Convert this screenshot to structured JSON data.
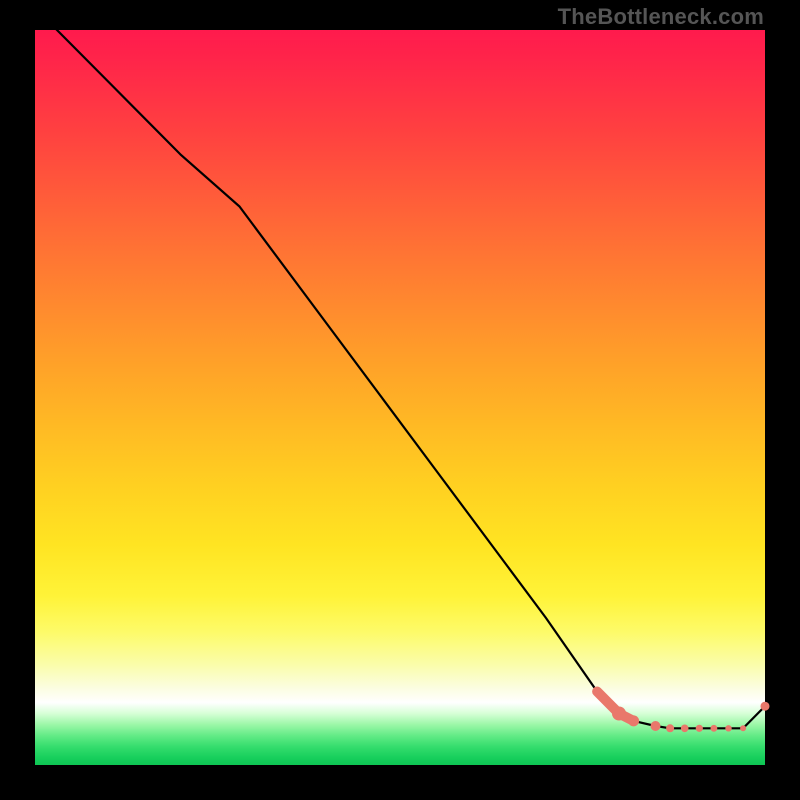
{
  "watermark": "TheBottleneck.com",
  "colors": {
    "line": "#000000",
    "marker_fill": "#e9786b",
    "marker_stroke": "#a24c42",
    "bg_black": "#000000"
  },
  "chart_data": {
    "type": "line",
    "title": "",
    "xlabel": "",
    "ylabel": "",
    "xlim": [
      0,
      100
    ],
    "ylim": [
      0,
      100
    ],
    "grid": false,
    "legend": false,
    "series": [
      {
        "name": "curve",
        "x": [
          0,
          10,
          20,
          28,
          40,
          55,
          70,
          77,
          80,
          82,
          85,
          87,
          89,
          91,
          93,
          95,
          97,
          100
        ],
        "y": [
          103,
          93,
          83,
          76,
          60,
          40,
          20,
          10,
          7,
          6,
          5.3,
          5,
          5,
          5,
          5,
          5,
          5,
          8
        ]
      }
    ],
    "markers": [
      {
        "x": 80,
        "y": 7,
        "r": 7
      },
      {
        "x": 82,
        "y": 6,
        "r": 5.5
      },
      {
        "x": 85,
        "y": 5.3,
        "r": 5
      },
      {
        "x": 87,
        "y": 5,
        "r": 4
      },
      {
        "x": 89,
        "y": 5,
        "r": 3.8
      },
      {
        "x": 91,
        "y": 5,
        "r": 3.6
      },
      {
        "x": 93,
        "y": 5,
        "r": 3.4
      },
      {
        "x": 95,
        "y": 5,
        "r": 3.2
      },
      {
        "x": 97,
        "y": 5,
        "r": 3
      },
      {
        "x": 100,
        "y": 8,
        "r": 4.5
      }
    ],
    "thick_segment": {
      "from_idx": 7,
      "to_idx": 9,
      "width": 10
    }
  }
}
